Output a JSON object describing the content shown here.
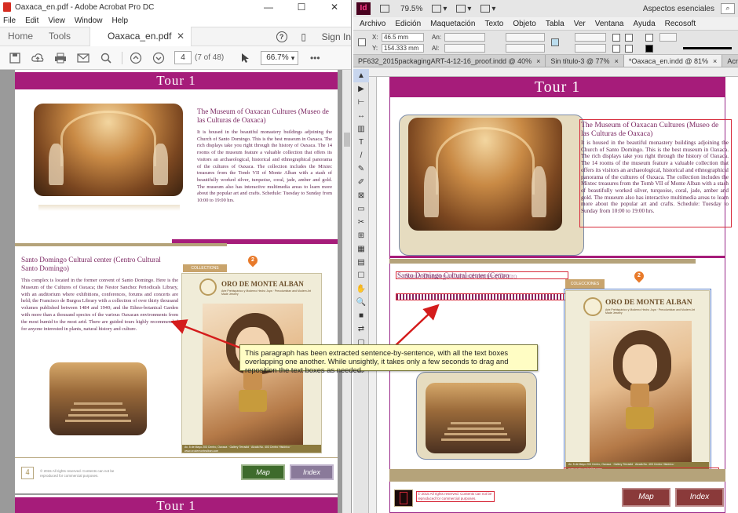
{
  "acrobat": {
    "title": "Oaxaca_en.pdf - Adobe Acrobat Pro DC",
    "window_controls": [
      "—",
      "☐",
      "✕"
    ],
    "menu": [
      "File",
      "Edit",
      "View",
      "Window",
      "Help"
    ],
    "tabs": {
      "home": "Home",
      "tools": "Tools",
      "doc": "Oaxaca_en.pdf",
      "signin": "Sign In"
    },
    "toolbar": {
      "page": "4",
      "page_of": "(7 of 48)",
      "zoom": "66.7%",
      "more": "•••"
    }
  },
  "brochure": {
    "tour_title": "Tour 1",
    "museum_heading": "The Museum of Oaxacan Cultures (Museo de las Culturas de Oaxaca)",
    "museum_text": "It is housed in the beautiful monastery buildings adjoining the Church of Santo Domingo. This is the best museum in Oaxaca. The rich displays take you right through the history of Oaxaca. The 14 rooms of the museum feature a valuable collection that offers its visitors an archaeological, historical and ethnographical panorama of the cultures of Oaxaca. The collection includes the Mixtec treasures from the Tomb VII of Monte Alban with a stash of beautifully worked silver, turquoise, coral, jade, amber and gold. The museum also has interactive multimedia areas to learn more about the popular art and crafts. Schedule: Tuesday to Sunday from 10:00 to 19:00 hrs.",
    "santo_heading": "Santo Domingo Cultural center (Centro Cultural Santo Domingo)",
    "santo_text": "This complex is located in the former convent of Santo Domingo. Here is the Museum of the Cultures of Oaxaca; the Nestor Sanchez Periodicals Library, with an auditorium where exhibitions, conferences, forums and concerts are held; the Francisco de Burgoa Library with a collection of over thirty thousand volumes published between 1484 and 1940; and the Ethno-botanical Garden with more than a thousand species of the various Oaxacan environments from the most humid to the most arid. There are guided tours highly recommended for anyone interested in plants, natural history and culture.",
    "collections_tag": "COLLECTIONS",
    "pin_number": "2",
    "ad_brand": "ORO DE MONTE ALBAN",
    "ad_sub": "Arte Prehispánico y Moderno Hecho Joya · Precolumbian and Modern Art Made Jewelry",
    "ad_footer": "Av. 5 de Mayo 203 Centro, Oaxaca · Gallery Terradid · Alcalá No. 403 Centro Histórico · www.orodemontealban.com",
    "copyright": "© 2015 All rights reserved. Contents can not be reproduced for commercial purposes.",
    "page_number": "4",
    "map_button": "Map",
    "index_button": "Index"
  },
  "indesign": {
    "logo": "Id",
    "zoom": "79.5%",
    "workspace": "Aspectos esenciales",
    "menu": [
      "Archivo",
      "Edición",
      "Maquetación",
      "Texto",
      "Objeto",
      "Tabla",
      "Ver",
      "Ventana",
      "Ayuda",
      "Recosoft"
    ],
    "control": {
      "x_label": "X:",
      "x_value": "46.5 mm",
      "y_label": "Y:",
      "y_value": "154.333 mm",
      "w_label": "An:",
      "h_label": "Al:"
    },
    "tabs": [
      {
        "label": "PF632_2015packagingART-4-12-16_proof.indd @ 40%",
        "close": "×"
      },
      {
        "label": "Sin título-3 @ 77%",
        "close": "×"
      },
      {
        "label": "*Oaxaca_en.indd @ 81%",
        "close": "×"
      },
      {
        "label": "Acrobat expo",
        "close": ""
      }
    ],
    "tools": [
      "▲",
      "▶",
      "⊢",
      "↔",
      "▥",
      "T",
      "/",
      "✎",
      "✐",
      "⊠",
      "▭",
      "✂",
      "⊞",
      "▦",
      "▤",
      "☐",
      "✋",
      "🔍",
      "■",
      "⇄",
      "▢",
      "⊟",
      "▣"
    ],
    "overlap_heading": "Santo Domingo Cultural center (Centro",
    "collections_tag": "COLECCIONES",
    "pin_number": "2"
  },
  "callout": {
    "text": "This paragraph has been extracted sentence-by-sentence, with all the text boxes overlapping one another. While unsightly, it takes only a few seconds to drag and reposition the text boxes as needed."
  },
  "colors": {
    "magenta": "#a61c7a",
    "gold": "#b99b5c",
    "callout_bg": "#fffdc4",
    "frame_red": "#d72a3a",
    "frame_blue": "#5a7fc6"
  }
}
